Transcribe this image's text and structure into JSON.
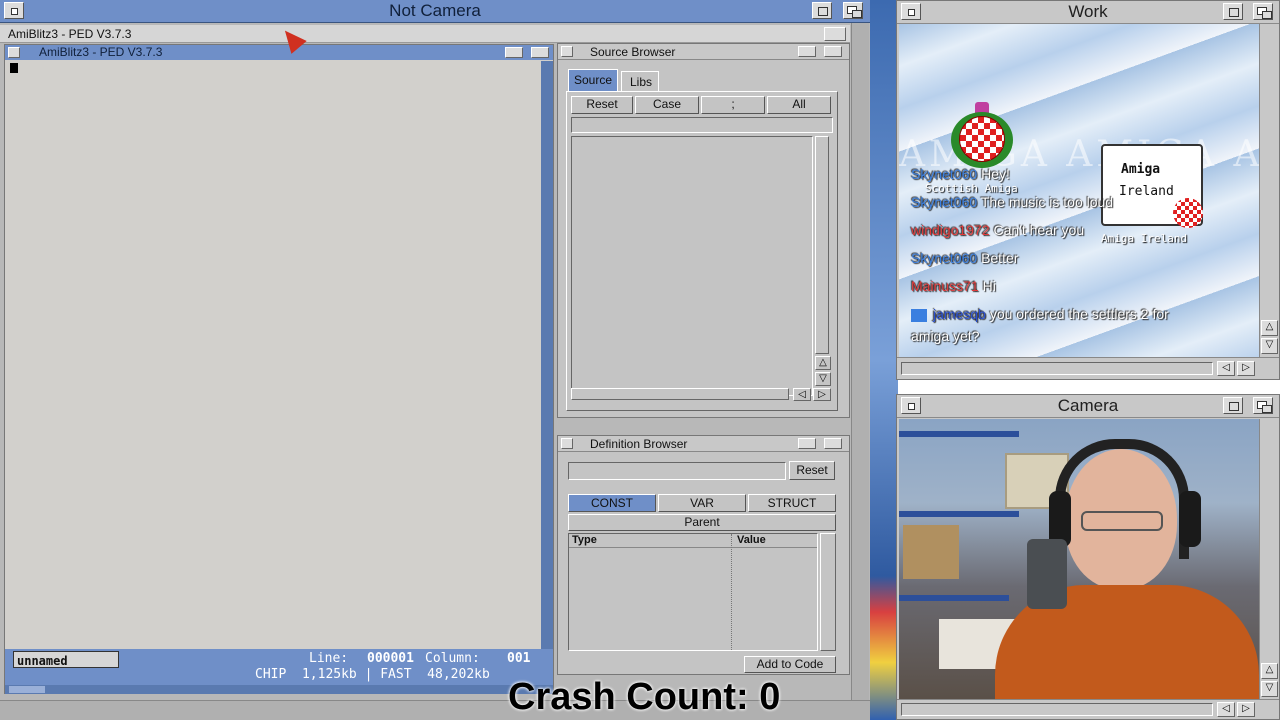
{
  "main_window": {
    "title": "Not Camera"
  },
  "ped_screen": {
    "title": "AmiBlitz3 - PED V3.7.3"
  },
  "editor_window": {
    "title": "AmiBlitz3 - PED V3.7.3",
    "filename": "unnamed",
    "line_label": "Line:",
    "line_value": "000001",
    "column_label": "Column:",
    "column_value": "001",
    "memory": "CHIP  1,125kb | FAST  48,202kb"
  },
  "source_browser": {
    "title": "Source Browser",
    "tabs": [
      {
        "label": "Source",
        "active": true
      },
      {
        "label": "Libs",
        "active": false
      }
    ],
    "buttons": [
      "Reset",
      "Case",
      ";",
      "All"
    ]
  },
  "definition_browser": {
    "title": "Definition Browser",
    "reset_label": "Reset",
    "tabs": [
      "CONST",
      "VAR",
      "STRUCT"
    ],
    "parent_label": "Parent",
    "columns": [
      "Type",
      "Value"
    ],
    "add_to_code": "Add to Code"
  },
  "overlay": {
    "crash_count": "Crash Count: 0"
  },
  "work_window": {
    "title": "Work",
    "logos": {
      "scottish": "Scottish Amiga",
      "ireland_top": "Amiga",
      "ireland_mid": "Ireland",
      "ireland_bottom": "Amiga Ireland"
    },
    "chat": [
      {
        "user": "Skynet060",
        "message": "Hey!",
        "color": "#3a7fe0"
      },
      {
        "user": "Skynet060",
        "message": "The music is too loud",
        "color": "#3a7fe0"
      },
      {
        "user": "windigo1972",
        "message": "Can't hear you",
        "color": "#e03a3a"
      },
      {
        "user": "Skynet060",
        "message": "Better",
        "color": "#3a7fe0"
      },
      {
        "user": "Mainuss71",
        "message": "Hi",
        "color": "#e03a3a"
      },
      {
        "user": "jamesqb",
        "message": "you ordered the settlers 2 for",
        "color": "#2a50d0"
      }
    ],
    "chat_continuation": "amiga yet?"
  },
  "camera_window": {
    "title": "Camera"
  },
  "colors": {
    "titlebar_active": "#6f8fc8",
    "titlebar_inactive": "#c8c8c8",
    "workbench_gray": "#c4c4c4",
    "tab_active": "#6f8fc8"
  }
}
